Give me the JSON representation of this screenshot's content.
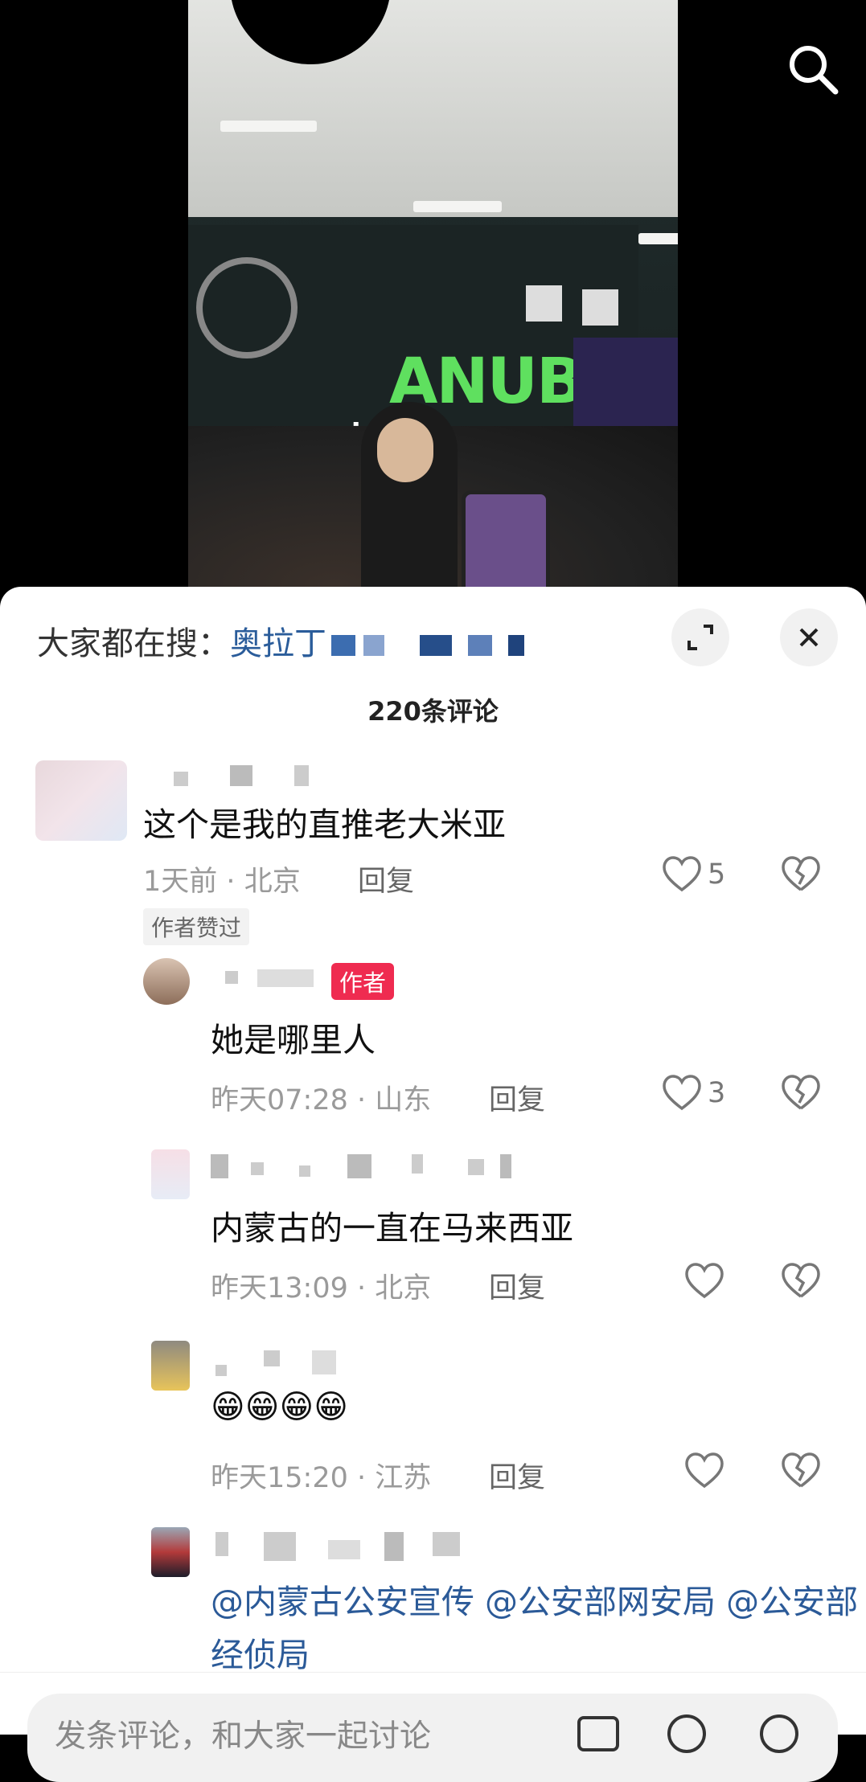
{
  "suggest": {
    "label": "大家都在搜：",
    "term": "奥拉丁"
  },
  "comments_count": "220条评论",
  "comments": [
    {
      "text": "这个是我的直推老大米亚",
      "time": "1天前",
      "location": "北京",
      "reply": "回复",
      "likes": "5",
      "tag": "作者赞过"
    },
    {
      "text": "她是哪里人",
      "time": "昨天07:28",
      "location": "山东",
      "reply": "回复",
      "likes": "3",
      "author_tag": "作者"
    },
    {
      "text": "内蒙古的一直在马来西亚",
      "time": "昨天13:09",
      "location": "北京",
      "reply": "回复"
    },
    {
      "text": "😁😁😁😁",
      "time": "昨天15:20",
      "location": "江苏",
      "reply": "回复"
    },
    {
      "text": "@内蒙古公安宣传 @公安部网安局 @公安部经侦局"
    }
  ],
  "input": {
    "placeholder": "发条评论，和大家一起讨论"
  },
  "dot": "·",
  "icons": [
    "search-icon",
    "expand-icon",
    "close-icon",
    "heart-icon",
    "broken-heart-icon",
    "image-icon",
    "at-icon",
    "emoji-icon"
  ]
}
